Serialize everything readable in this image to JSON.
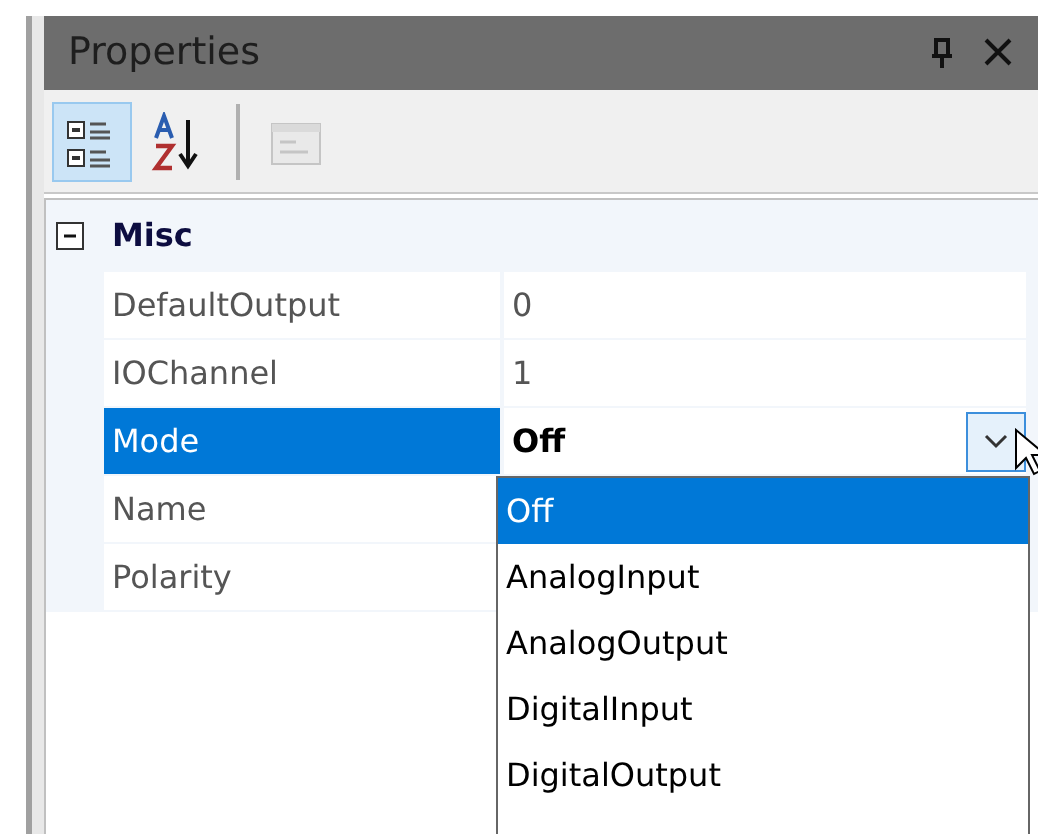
{
  "window": {
    "title": "Properties",
    "title_buttons": [
      {
        "kind": "pin"
      },
      {
        "kind": "close"
      }
    ]
  },
  "toolbar": [
    {
      "kind": "categorized",
      "selected": true,
      "disabled": false
    },
    {
      "kind": "alphabetical",
      "selected": false,
      "disabled": false
    },
    {
      "kind": "property-pages",
      "selected": false,
      "disabled": true
    }
  ],
  "categories": [
    {
      "label": "Misc",
      "expanded": true,
      "properties": [
        {
          "name": "DefaultOutput",
          "value": "0",
          "selected": false
        },
        {
          "name": "IOChannel",
          "value": "1",
          "selected": false
        },
        {
          "name": "Mode",
          "value": "Off",
          "selected": true,
          "dropdown_open": true,
          "options": [
            {
              "label": "Off",
              "selected": true
            },
            {
              "label": "AnalogInput",
              "selected": false
            },
            {
              "label": "AnalogOutput",
              "selected": false
            },
            {
              "label": "DigitalInput",
              "selected": false
            },
            {
              "label": "DigitalOutput",
              "selected": false
            }
          ]
        },
        {
          "name": "Name",
          "selected": false
        },
        {
          "name": "Polarity",
          "selected": false
        }
      ]
    }
  ]
}
